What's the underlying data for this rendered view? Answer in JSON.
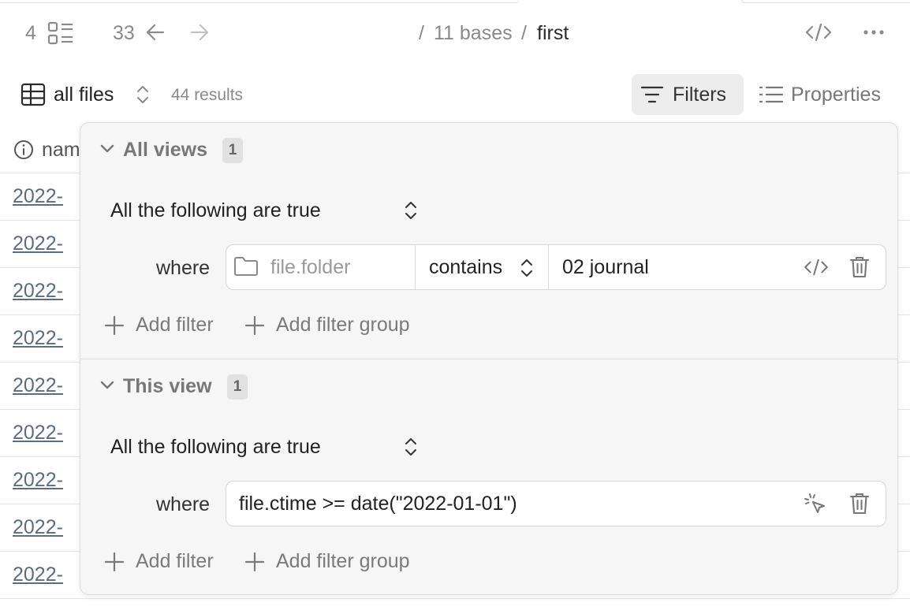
{
  "header": {
    "views_count": "4",
    "history_count": "33",
    "breadcrumb_sep": "/",
    "breadcrumb_parent": "11 bases",
    "breadcrumb_current": "first"
  },
  "toolbar": {
    "view_name": "all files",
    "results": "44 results",
    "filters_label": "Filters",
    "properties_label": "Properties"
  },
  "table": {
    "column_name": "nam",
    "rows": [
      "2022-",
      "2022-",
      "2022-",
      "2022-",
      "2022-",
      "2022-",
      "2022-",
      "2022-",
      "2022-"
    ]
  },
  "filters": {
    "all_views": {
      "title": "All views",
      "count": "1",
      "conjunction": "All the following are true",
      "where_label": "where",
      "condition": {
        "property": "file.folder",
        "operator": "contains",
        "value": "02 journal"
      },
      "add_filter": "Add filter",
      "add_filter_group": "Add filter group"
    },
    "this_view": {
      "title": "This view",
      "count": "1",
      "conjunction": "All the following are true",
      "where_label": "where",
      "expression": "file.ctime >= date(\"2022-01-01\")",
      "add_filter": "Add filter",
      "add_filter_group": "Add filter group"
    }
  },
  "icons": {
    "views": "list-layout-icon",
    "back": "arrow-left-icon",
    "forward": "arrow-right-icon",
    "code": "code-icon",
    "more": "more-horizontal-icon",
    "table": "table-icon",
    "sort": "chevrons-up-down-icon",
    "filter": "filter-lines-icon",
    "properties": "list-icon",
    "info": "info-icon",
    "folder": "folder-icon",
    "trash": "trash-icon",
    "cursor": "mouse-pointer-click-icon",
    "plus": "plus-icon",
    "chevron": "chevron-down-icon"
  },
  "colors": {
    "popover_bg": "#f6f6f6",
    "filters_btn_bg": "#ededed",
    "link": "#5b6e7f"
  }
}
